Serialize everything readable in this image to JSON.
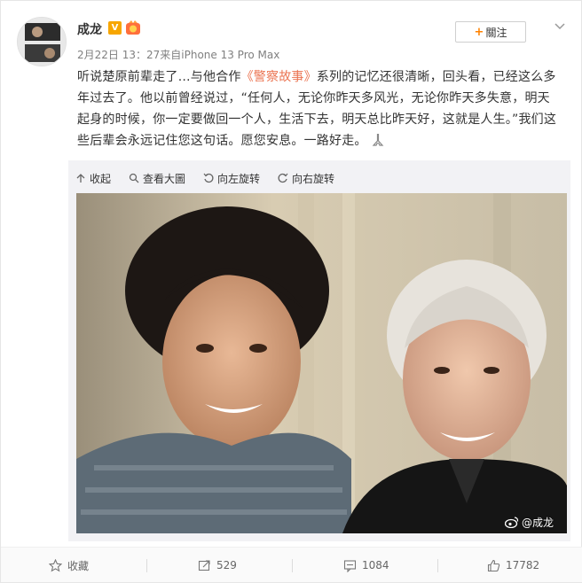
{
  "author": {
    "name": "成龙",
    "verified_badge": "V"
  },
  "meta": {
    "time": "2月22日 13：27",
    "source_prefix": "来自",
    "device": "iPhone 13 Pro Max"
  },
  "follow_label": "關注",
  "post": {
    "part1": "听说楚原前辈走了…与他合作",
    "link": "《警察故事》",
    "part2": "系列的记忆还很清晰，回头看，已经这么多年过去了。他以前曾经说过，“任何人，无论你昨天多风光，无论你昨天多失意，明天起身的时候，你一定要做回一个人，生活下去，明天总比昨天好，这就是人生。”我们这些后辈会永远记住您这句话。愿您安息。一路好走。"
  },
  "toolbar": {
    "collapse": "收起",
    "view_large": "查看大圖",
    "rotate_left": "向左旋转",
    "rotate_right": "向右旋转"
  },
  "watermark": "@成龙",
  "actions": {
    "favorite": "收藏",
    "repost": "529",
    "comments": "1084",
    "likes": "17782"
  },
  "colors": {
    "accent": "#eb7350",
    "follow_plus": "#ff8200",
    "badge": "#f7a600"
  }
}
